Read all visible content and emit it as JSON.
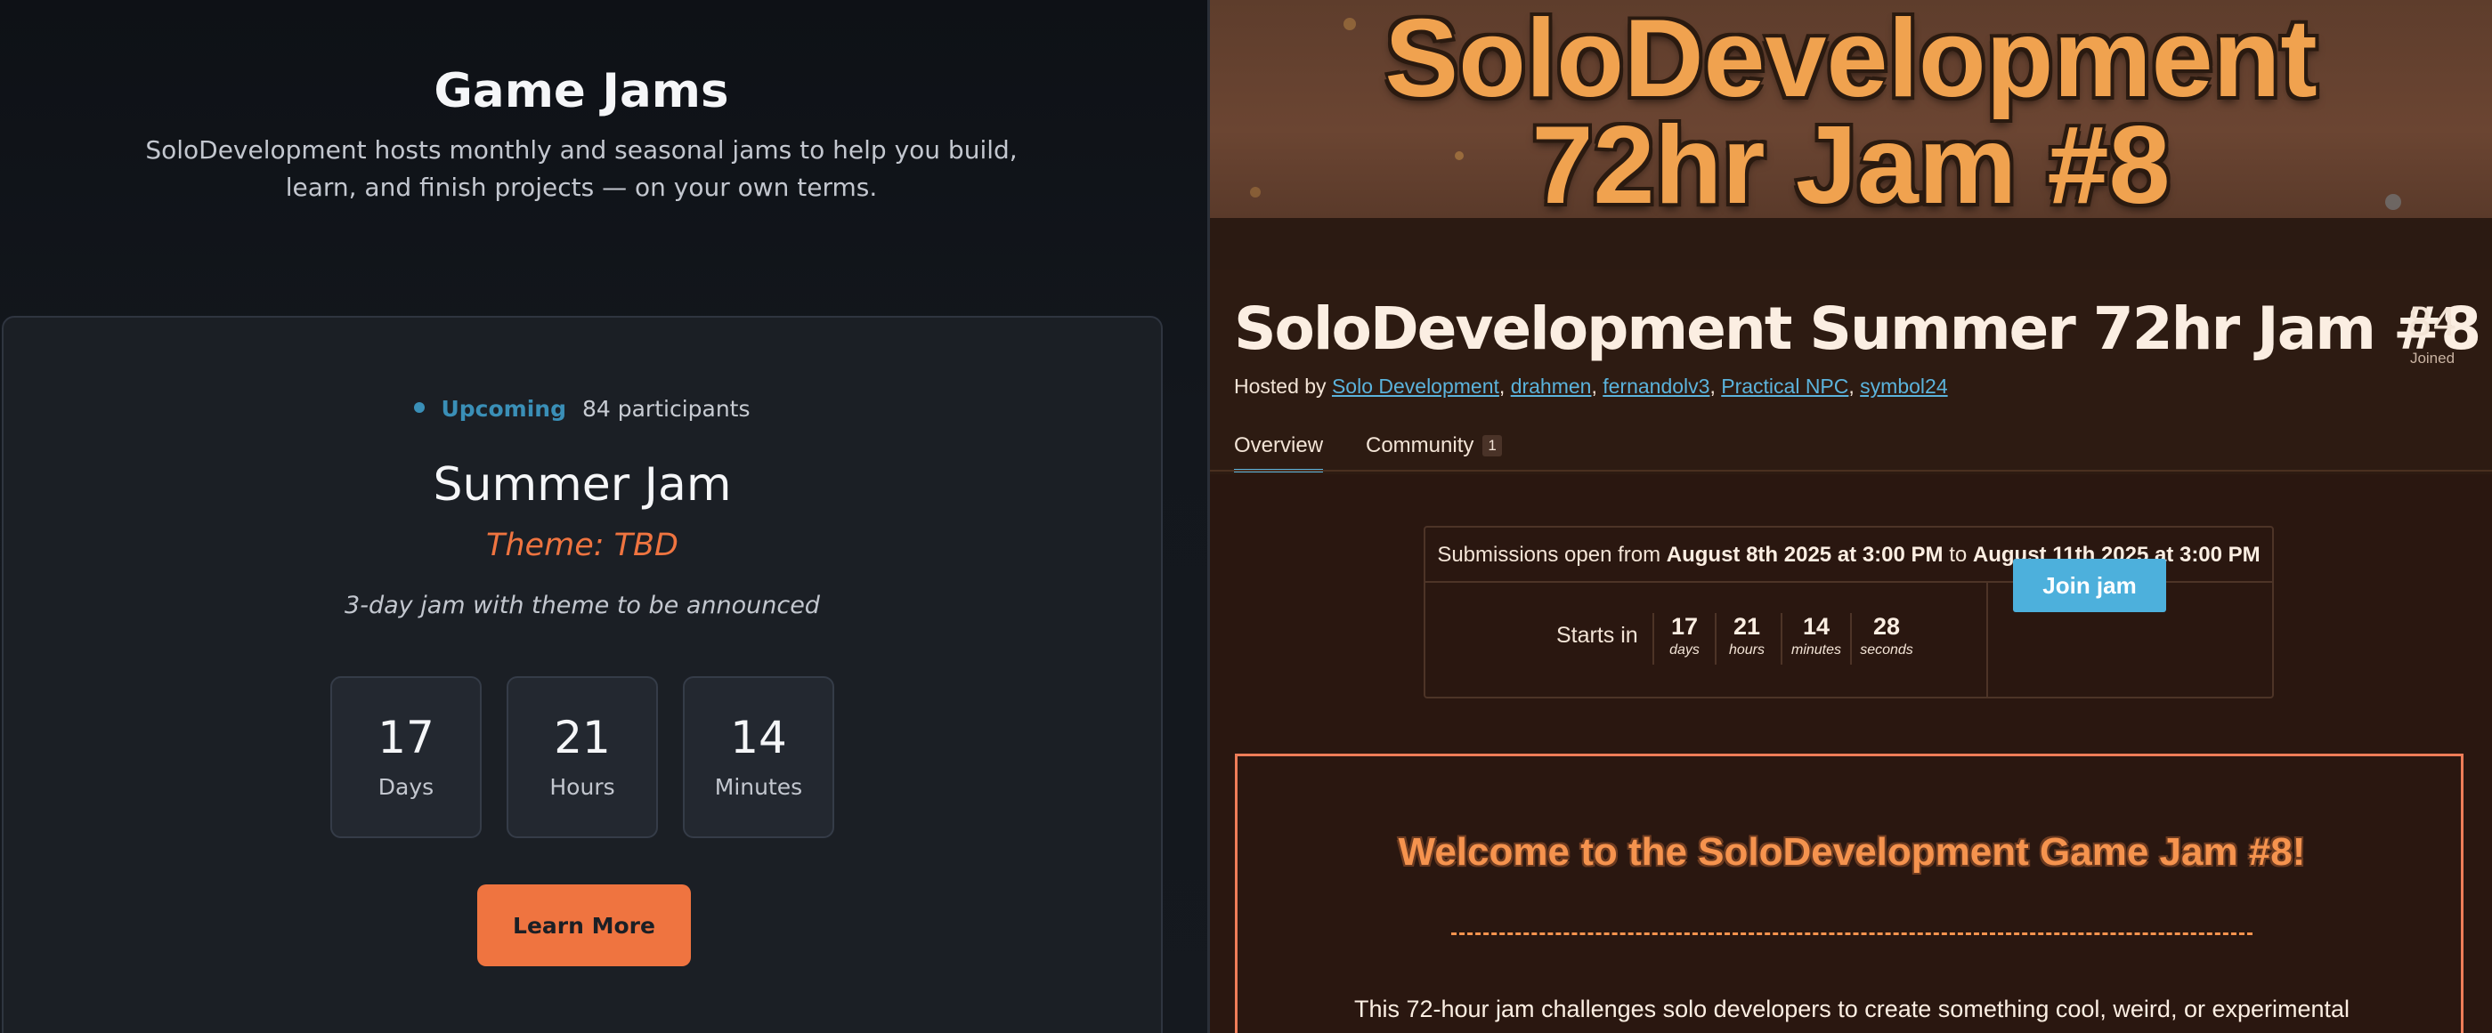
{
  "left": {
    "title": "Game Jams",
    "subtitle": "SoloDevelopment hosts monthly and seasonal jams to help you build, learn, and finish projects — on your own terms.",
    "card": {
      "status": "Upcoming",
      "participants": "84 participants",
      "name": "Summer Jam",
      "theme": "Theme: TBD",
      "description": "3-day jam with theme to be announced",
      "countdown": [
        {
          "value": "17",
          "label": "Days"
        },
        {
          "value": "21",
          "label": "Hours"
        },
        {
          "value": "14",
          "label": "Minutes"
        }
      ],
      "button": "Learn More"
    },
    "colors": {
      "accent": "#ef7440",
      "status": "#3a8fb7"
    }
  },
  "right": {
    "banner": {
      "line1": "SoloDevelopment",
      "line2": "72hr Jam #8"
    },
    "title": "SoloDevelopment Summer 72hr Jam #8",
    "hosted_prefix": "Hosted by ",
    "hosts": [
      "Solo Development",
      "drahmen",
      "fernandolv3",
      "Practical NPC",
      "symbol24"
    ],
    "joined": {
      "count": "84",
      "label": "Joined"
    },
    "tabs": [
      {
        "label": "Overview",
        "active": true
      },
      {
        "label": "Community",
        "badge": "1",
        "active": false
      }
    ],
    "submissions": {
      "prefix": "Submissions open from",
      "start": "August 8th 2025 at 3:00 PM",
      "mid": "to",
      "end": "August 11th 2025 at 3:00 PM"
    },
    "starts_in": "Starts in",
    "countdown": [
      {
        "value": "17",
        "unit": "days"
      },
      {
        "value": "21",
        "unit": "hours"
      },
      {
        "value": "14",
        "unit": "minutes"
      },
      {
        "value": "28",
        "unit": "seconds"
      }
    ],
    "join_button": "Join jam",
    "welcome": {
      "title": "Welcome to the SoloDevelopment Game Jam #8!",
      "body": "This 72-hour jam challenges solo developers to create something cool, weird, or experimental"
    },
    "colors": {
      "link": "#5bb3dc",
      "button": "#4db0dc",
      "welcome": "#f5934e"
    }
  }
}
